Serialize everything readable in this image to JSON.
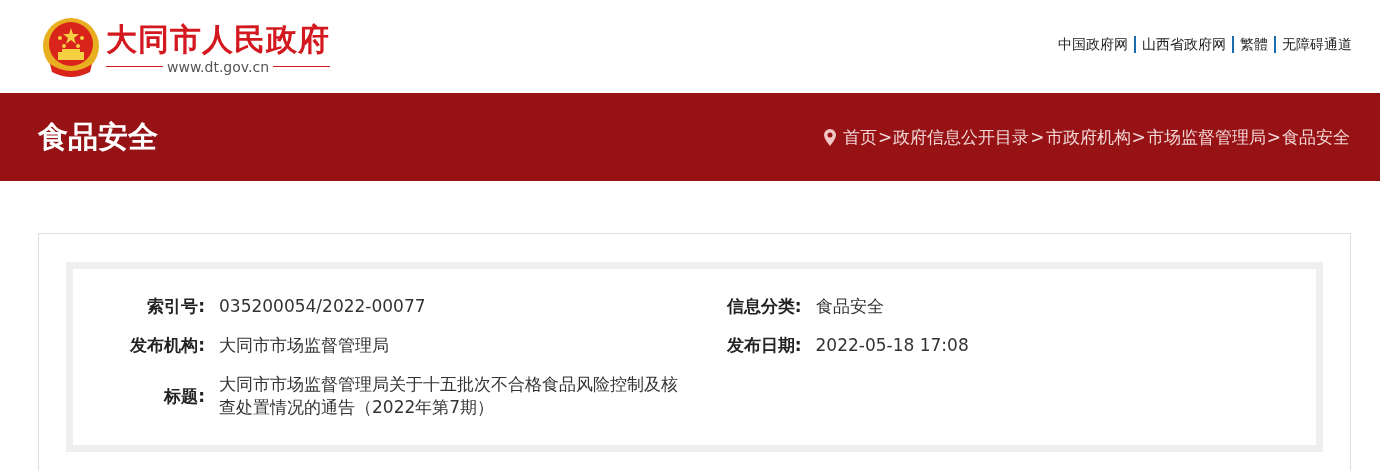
{
  "header": {
    "site_title": "大同市人民政府",
    "site_url": "www.dt.gov.cn",
    "top_links": [
      {
        "label": "中国政府网"
      },
      {
        "label": "山西省政府网"
      },
      {
        "label": "繁體"
      },
      {
        "label": "无障碍通道"
      }
    ]
  },
  "banner": {
    "title": "食品安全",
    "breadcrumb_separator": ">",
    "breadcrumb": [
      {
        "label": "首页"
      },
      {
        "label": "政府信息公开目录"
      },
      {
        "label": "市政府机构"
      },
      {
        "label": "市场监督管理局"
      },
      {
        "label": "食品安全"
      }
    ]
  },
  "meta": [
    {
      "label": "索引号:",
      "value": "035200054/2022-00077",
      "kind": "half"
    },
    {
      "label": "信息分类:",
      "value": "食品安全",
      "kind": "half"
    },
    {
      "label": "发布机构:",
      "value": "大同市市场监督管理局",
      "kind": "half"
    },
    {
      "label": "发布日期:",
      "value": "2022-05-18 17:08",
      "kind": "half"
    },
    {
      "label": "标题:",
      "value": "大同市市场监督管理局关于十五批次不合格食品风险控制及核查处置情况的通告（2022年第7期）",
      "kind": "full"
    }
  ]
}
